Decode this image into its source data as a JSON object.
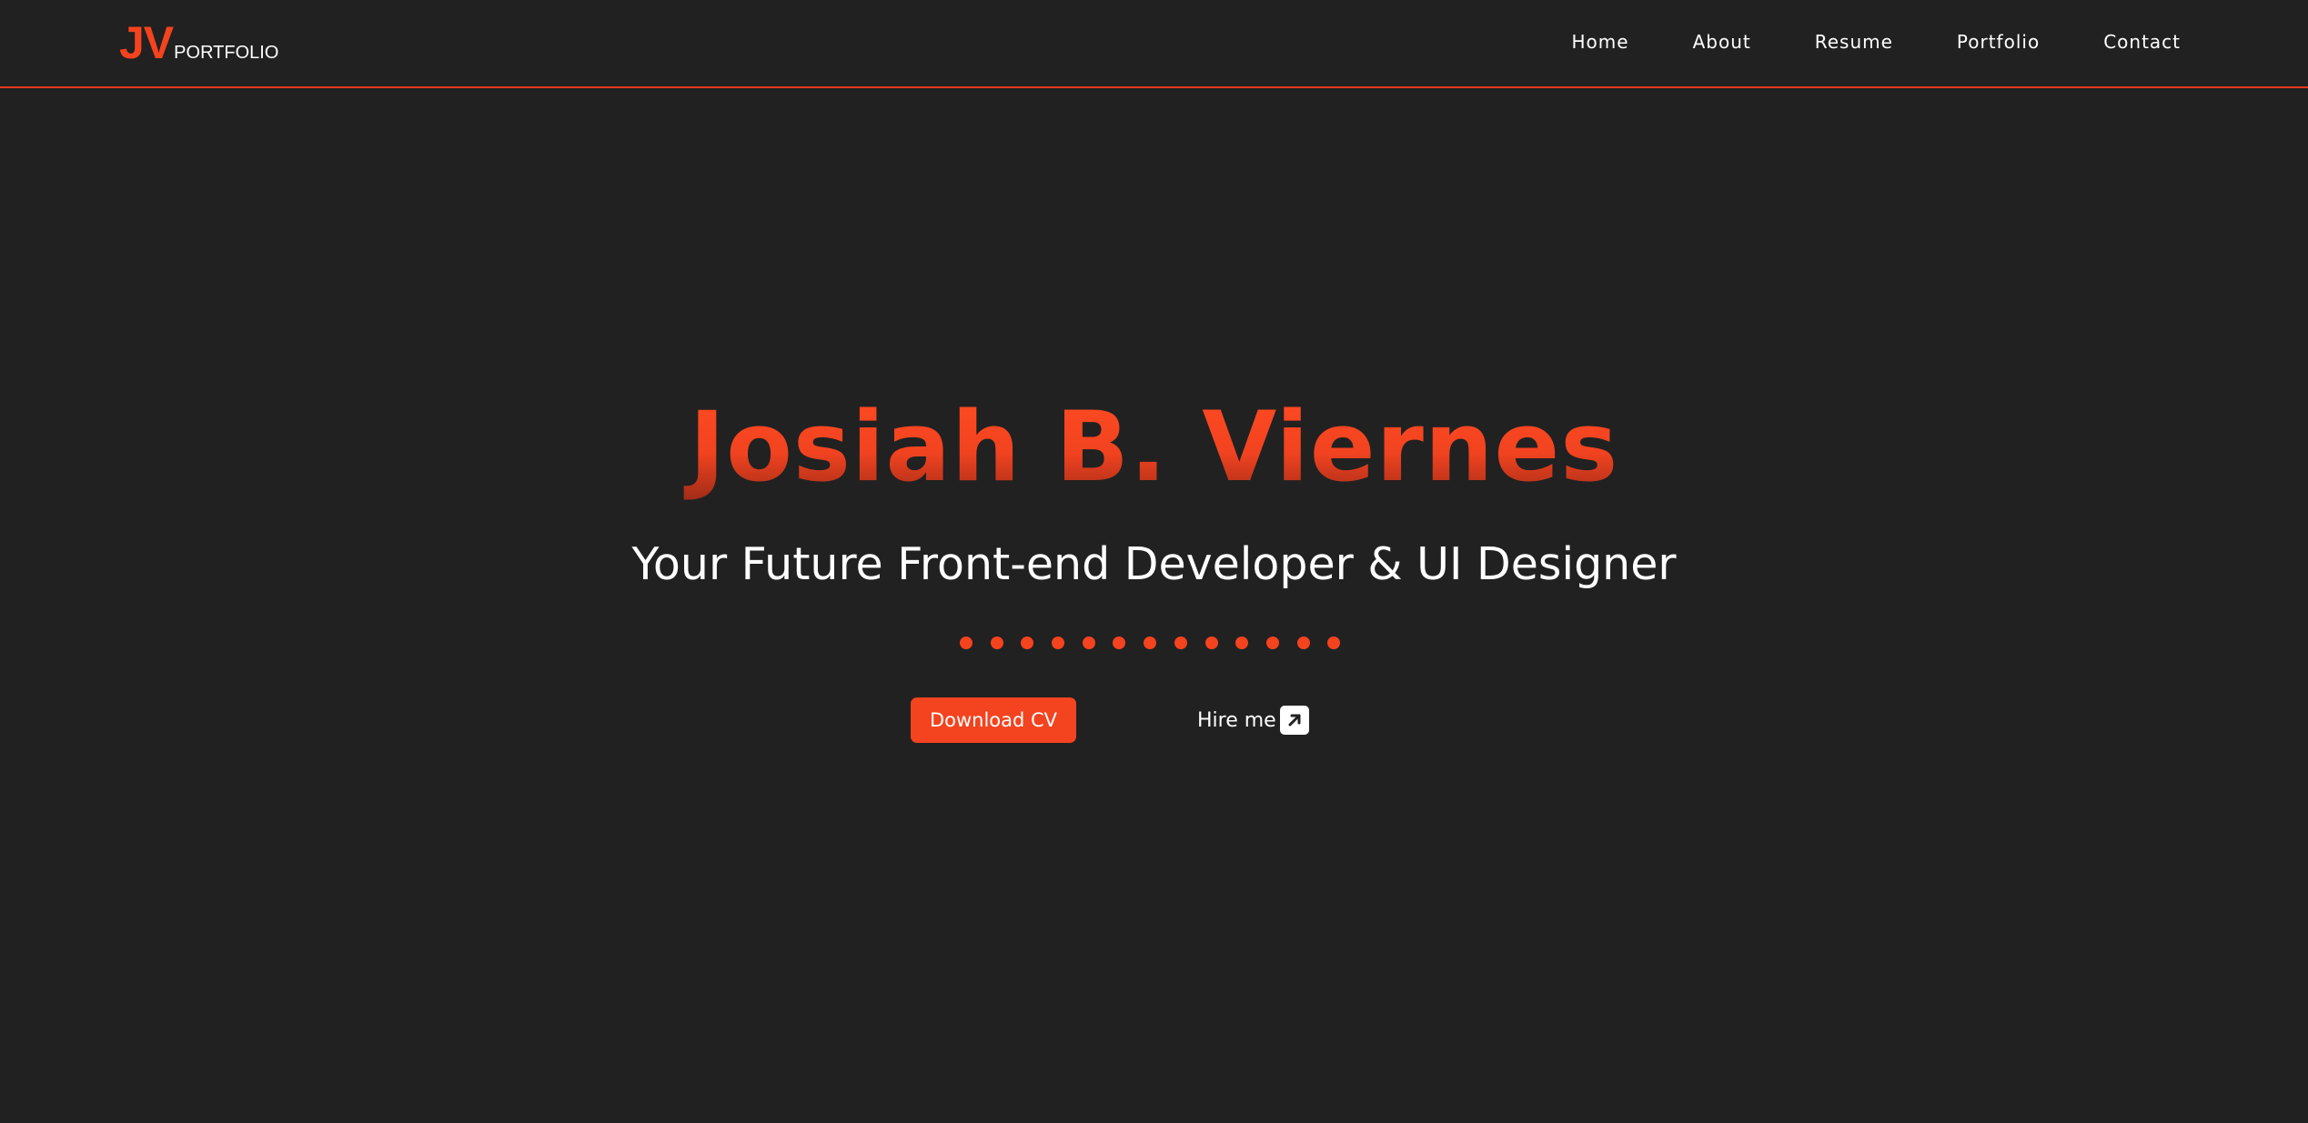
{
  "colors": {
    "background": "#212121",
    "accent": "#f4431f",
    "text": "#ffffff"
  },
  "logo": {
    "mark": "JV",
    "text": "PORTFOLIO"
  },
  "nav": {
    "items": [
      {
        "label": "Home"
      },
      {
        "label": "About"
      },
      {
        "label": "Resume"
      },
      {
        "label": "Portfolio"
      },
      {
        "label": "Contact"
      }
    ]
  },
  "hero": {
    "name": "Josiah B. Viernes",
    "subtitle": "Your Future Front-end Developer & UI Designer",
    "dot_count": 13,
    "download_button": "Download CV",
    "hire_button": "Hire me",
    "hire_icon": "arrow-up-right-icon"
  }
}
